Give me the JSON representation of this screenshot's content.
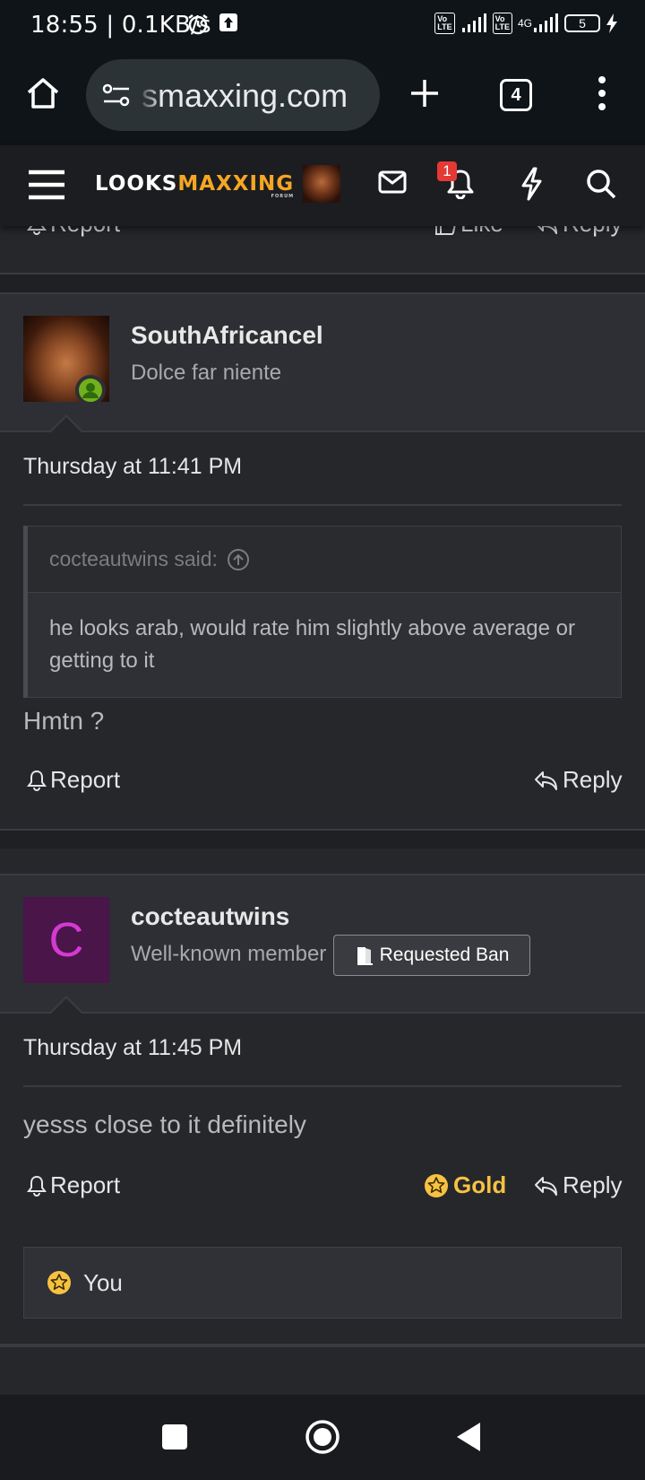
{
  "status_bar": {
    "time": "18:55 | 0.1KB/s",
    "network_type": "4G",
    "battery_level": "5"
  },
  "browser": {
    "url": "smaxxing.com",
    "tab_count": "4"
  },
  "site_header": {
    "logo_part1": "LOOKS",
    "logo_part2": "MAXXING",
    "logo_sub": "FORUM",
    "notification_count": "1"
  },
  "previous_post": {
    "report_label": "Report",
    "like_label": "Like",
    "reply_label": "Reply"
  },
  "posts": [
    {
      "username": "SouthAfricancel",
      "user_title": "Dolce far niente",
      "timestamp": "Thursday at 11:41 PM",
      "quote_author": "cocteautwins said:",
      "quote_text": "he looks arab, would rate him slightly above average or getting to it",
      "body": "Hmtn ?",
      "report_label": "Report",
      "reply_label": "Reply"
    },
    {
      "username": "cocteautwins",
      "avatar_letter": "C",
      "user_title": "Well-known member",
      "badge": "Requested Ban",
      "timestamp": "Thursday at 11:45 PM",
      "body": "yesss close to it definitely",
      "report_label": "Report",
      "gold_label": "Gold",
      "reply_label": "Reply",
      "reaction_user": "You"
    }
  ],
  "colors": {
    "accent_orange": "#f5a623",
    "gold": "#f5c242",
    "online_green": "#72b01d",
    "badge_red": "#e53935"
  }
}
